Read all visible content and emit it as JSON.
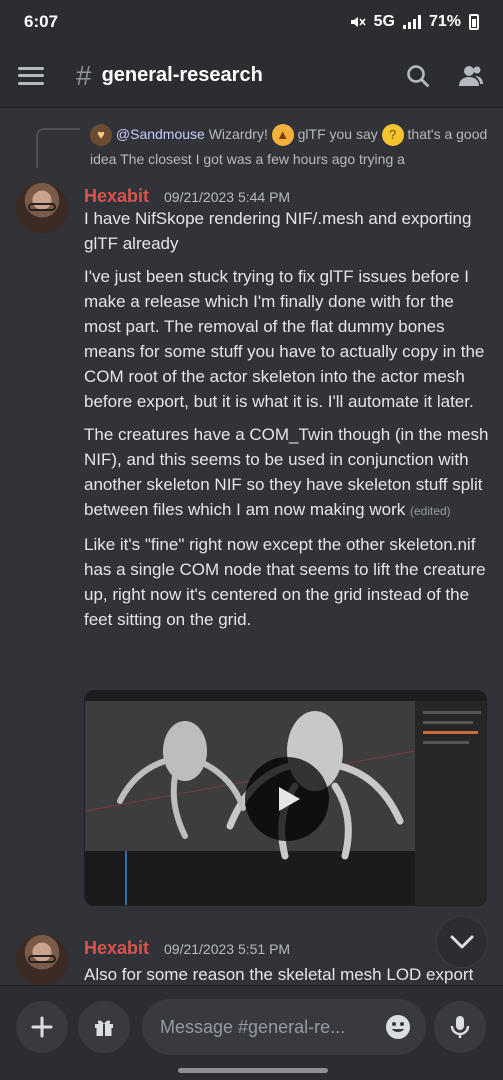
{
  "status": {
    "time": "6:07",
    "network": "5G",
    "battery": "71%"
  },
  "header": {
    "hash": "#",
    "channel": "general-research"
  },
  "reply": {
    "mention": "@Sandmouse",
    "text_1": "Wizardry!",
    "text_2": "glTF you say",
    "text_3": "that's a good idea  The closest I got was a few hours ago trying a"
  },
  "messages": [
    {
      "author": "Hexabit",
      "timestamp": "09/21/2023 5:44 PM",
      "paragraphs": [
        "I have NifSkope rendering NIF/.mesh and exporting glTF already",
        "I've just been stuck trying to fix glTF issues before I make a release which I'm finally done with for the most part.  The removal of the flat dummy bones means for some stuff you have to actually copy in the COM root of the actor skeleton into the actor mesh before export, but it is what it is.  I'll automate it later.",
        "The creatures have a COM_Twin though (in the mesh NIF), and this seems to be used in conjunction with another skeleton NIF so they have skeleton stuff split between files which I am now making work",
        "Like it's \"fine\" right now except the other skeleton.nif has a single COM node that seems to lift the creature up, right now it's centered on the grid instead of the feet sitting on the grid."
      ],
      "edited": "(edited)"
    },
    {
      "author": "Hexabit",
      "timestamp": "09/21/2023 5:51 PM",
      "paragraphs": [
        "Also for some reason the skeletal mesh LOD export"
      ]
    }
  ],
  "composer": {
    "placeholder": "Message #general-re..."
  },
  "colors": {
    "author": "#d9534f",
    "background": "#313338",
    "bar": "#2b2d31"
  },
  "icons": [
    "menu-icon",
    "hash-icon",
    "search-icon",
    "members-icon",
    "play-icon",
    "chevron-down-icon",
    "plus-icon",
    "gift-icon",
    "emoji-icon",
    "mic-icon"
  ]
}
